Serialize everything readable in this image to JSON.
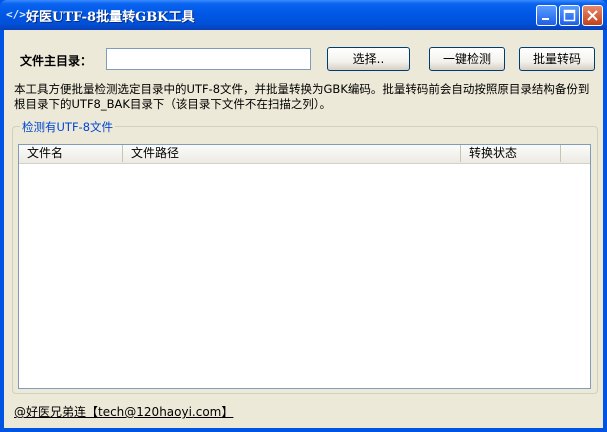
{
  "window": {
    "title": "好医UTF-8批量转GBK工具",
    "icon": "code-brackets-icon"
  },
  "form": {
    "dir_label": "文件主目录：",
    "dir_value": "",
    "browse_label": "选择..",
    "detect_label": "一键检测",
    "convert_label": "批量转码"
  },
  "description": "本工具方便批量检测选定目录中的UTF-8文件，并批量转换为GBK编码。批量转码前会自动按照原目录结构备份到根目录下的UTF8_BAK目录下（该目录下文件不在扫描之列）。",
  "group": {
    "title": "检测有UTF-8文件",
    "columns": [
      "文件名",
      "文件路径",
      "转换状态"
    ],
    "rows": []
  },
  "footer": {
    "contact": "@好医兄弟连【tech@120haoyi.com】"
  },
  "colors": {
    "titlebar": "#0058e6",
    "face": "#ece9d8",
    "group_title": "#0046d5"
  }
}
